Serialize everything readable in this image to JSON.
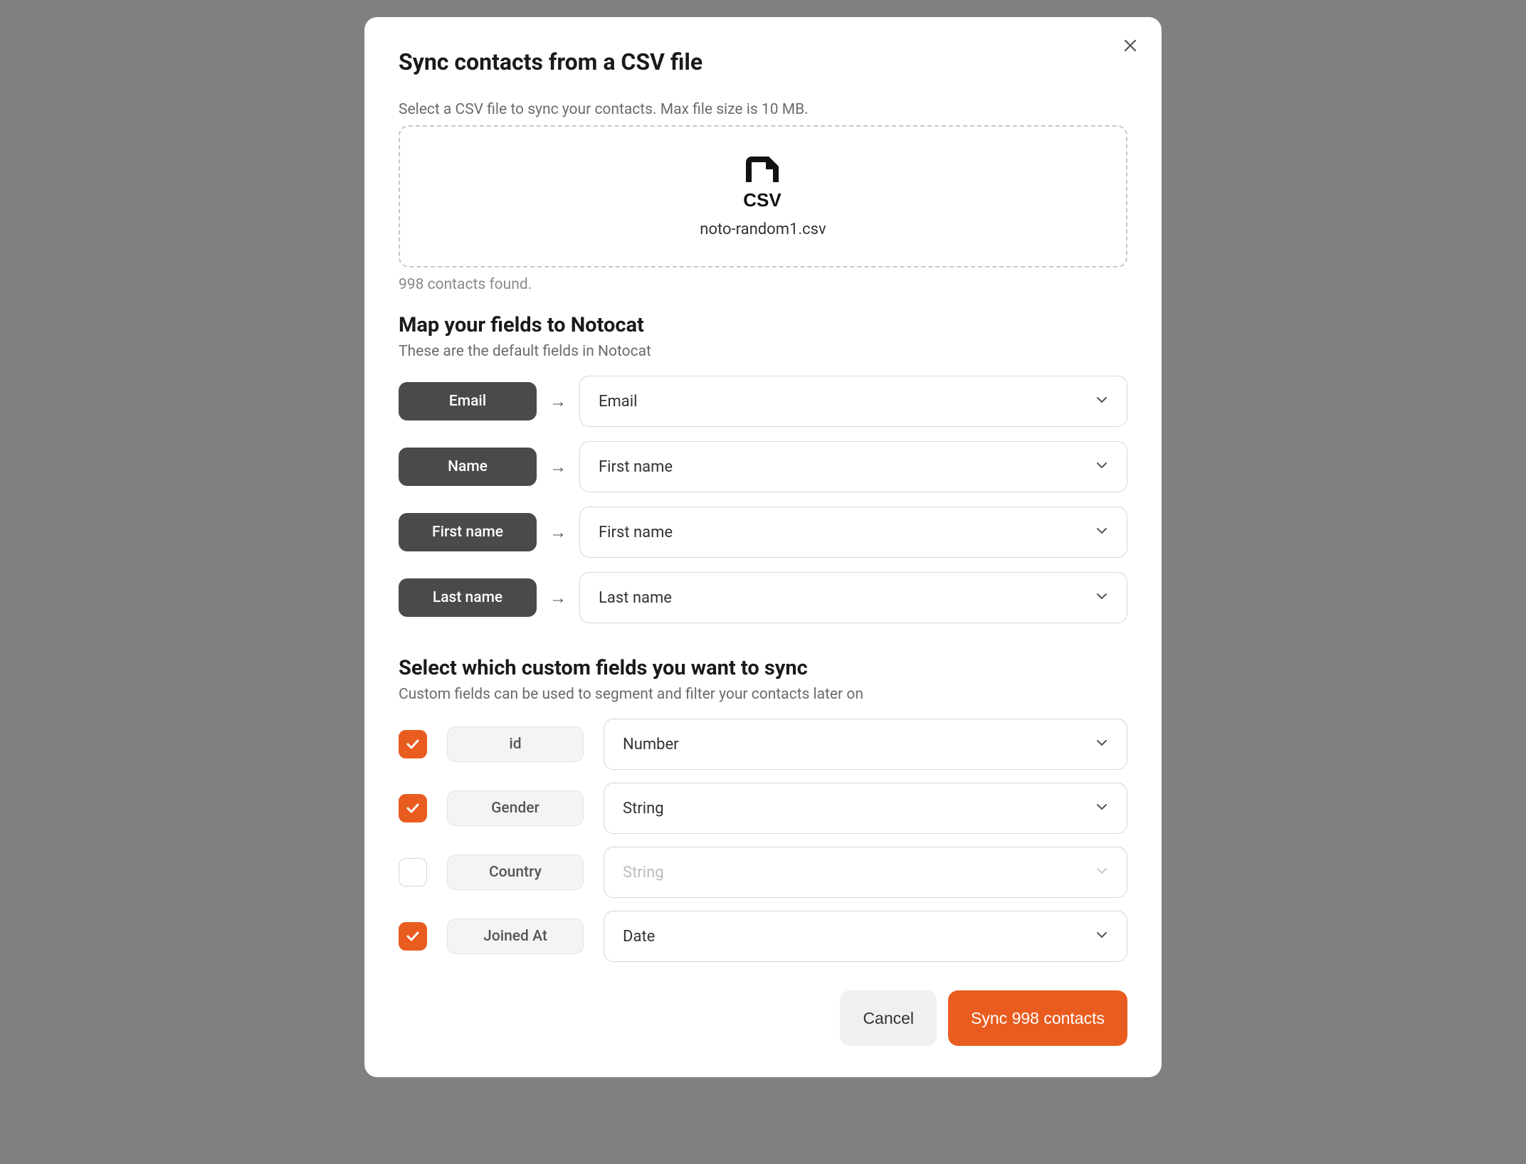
{
  "modal": {
    "title": "Sync contacts from a CSV file",
    "upload_hint": "Select a CSV file to sync your contacts. Max file size is 10 MB.",
    "filename": "noto-random1.csv",
    "contact_count": "998 contacts found."
  },
  "mapping": {
    "title": "Map your fields to Notocat",
    "subtitle": "These are the default fields in Notocat",
    "rows": [
      {
        "source": "Email",
        "target": "Email"
      },
      {
        "source": "Name",
        "target": "First name"
      },
      {
        "source": "First name",
        "target": "First name"
      },
      {
        "source": "Last name",
        "target": "Last name"
      }
    ]
  },
  "custom": {
    "title": "Select which custom fields you want to sync",
    "subtitle": "Custom fields can be used to segment and filter your contacts later on",
    "rows": [
      {
        "checked": true,
        "name": "id",
        "type": "Number"
      },
      {
        "checked": true,
        "name": "Gender",
        "type": "String"
      },
      {
        "checked": false,
        "name": "Country",
        "type": "String"
      },
      {
        "checked": true,
        "name": "Joined At",
        "type": "Date"
      }
    ]
  },
  "footer": {
    "cancel": "Cancel",
    "confirm": "Sync 998 contacts"
  }
}
